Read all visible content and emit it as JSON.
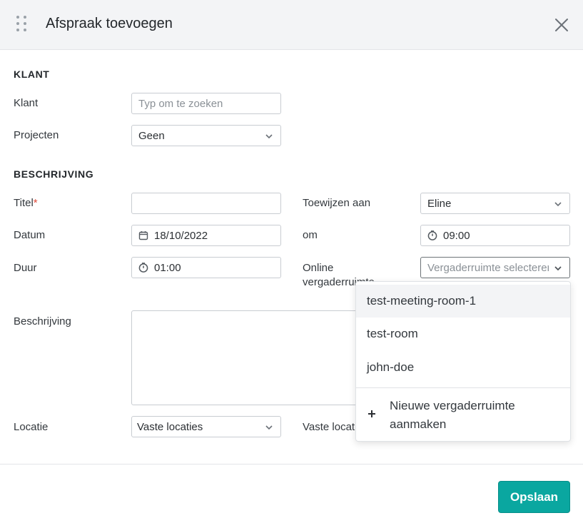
{
  "modal": {
    "title": "Afspraak toevoegen"
  },
  "klant_section": {
    "title": "KLANT",
    "klant_label": "Klant",
    "klant_placeholder": "Typ om te zoeken",
    "projecten_label": "Projecten",
    "projecten_value": "Geen"
  },
  "beschrijving_section": {
    "title": "BESCHRIJVING",
    "titel_label": "Titel",
    "titel_required": "*",
    "titel_value": "",
    "toewijzen_label": "Toewijzen aan",
    "toewijzen_value": "Eline",
    "datum_label": "Datum",
    "datum_value": "18/10/2022",
    "om_label": "om",
    "om_value": "09:00",
    "duur_label": "Duur",
    "duur_value": "01:00",
    "online_label": "Online vergaderruimte",
    "online_placeholder": "Vergaderruimte selecteren",
    "beschrijving_label": "Beschrijving",
    "locatie_label": "Locatie",
    "locatie_value": "Vaste locaties",
    "vaste_locatie_label": "Vaste locatie"
  },
  "dropdown": {
    "options": [
      "test-meeting-room-1",
      "test-room",
      "john-doe"
    ],
    "new_item": "Nieuwe vergaderruimte aanmaken"
  },
  "footer": {
    "save_label": "Opslaan"
  },
  "colors": {
    "accent": "#0aa7a0",
    "required": "#e04a3a"
  }
}
